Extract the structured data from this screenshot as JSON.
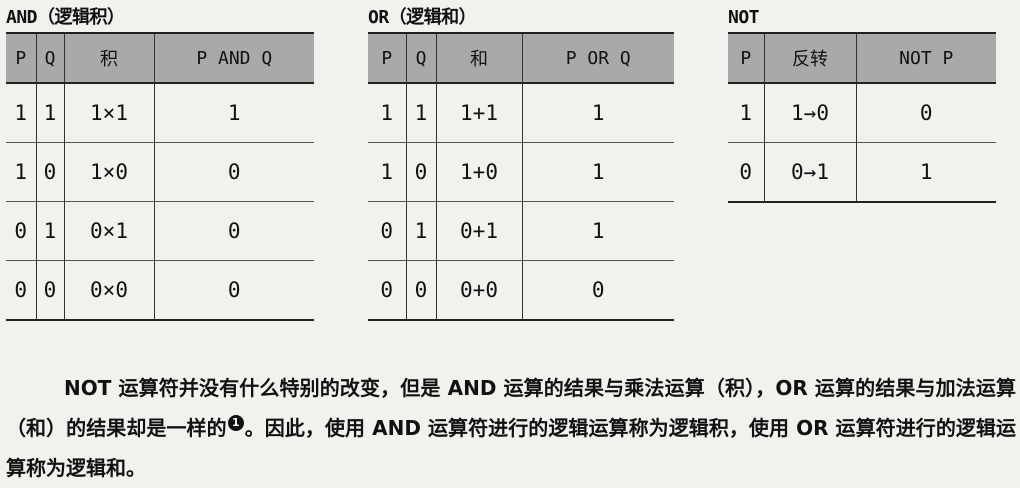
{
  "tables": [
    {
      "title": "AND（逻辑积）",
      "headers": [
        "P",
        "Q",
        "积",
        "P AND Q"
      ],
      "rows": [
        [
          "1",
          "1",
          "1×1",
          "1"
        ],
        [
          "1",
          "0",
          "1×0",
          "0"
        ],
        [
          "0",
          "1",
          "0×1",
          "0"
        ],
        [
          "0",
          "0",
          "0×0",
          "0"
        ]
      ]
    },
    {
      "title": "OR（逻辑和）",
      "headers": [
        "P",
        "Q",
        "和",
        "P OR Q"
      ],
      "rows": [
        [
          "1",
          "1",
          "1+1",
          "1"
        ],
        [
          "1",
          "0",
          "1+0",
          "1"
        ],
        [
          "0",
          "1",
          "0+1",
          "1"
        ],
        [
          "0",
          "0",
          "0+0",
          "0"
        ]
      ]
    },
    {
      "title": "NOT",
      "headers": [
        "P",
        "反转",
        "NOT P"
      ],
      "rows": [
        [
          "1",
          "1→0",
          "0"
        ],
        [
          "0",
          "0→1",
          "1"
        ]
      ]
    }
  ],
  "paragraph": {
    "before_note": "NOT 运算符并没有什么特别的改变，但是 AND 运算的结果与乘法运算（积），OR 运算的结果与加法运算（和）的结果却是一样的",
    "footnote_marker": "1",
    "after_note": "。因此，使用 AND 运算符进行的逻辑运算称为逻辑积，使用 OR 运算符进行的逻辑运算称为逻辑和。"
  }
}
